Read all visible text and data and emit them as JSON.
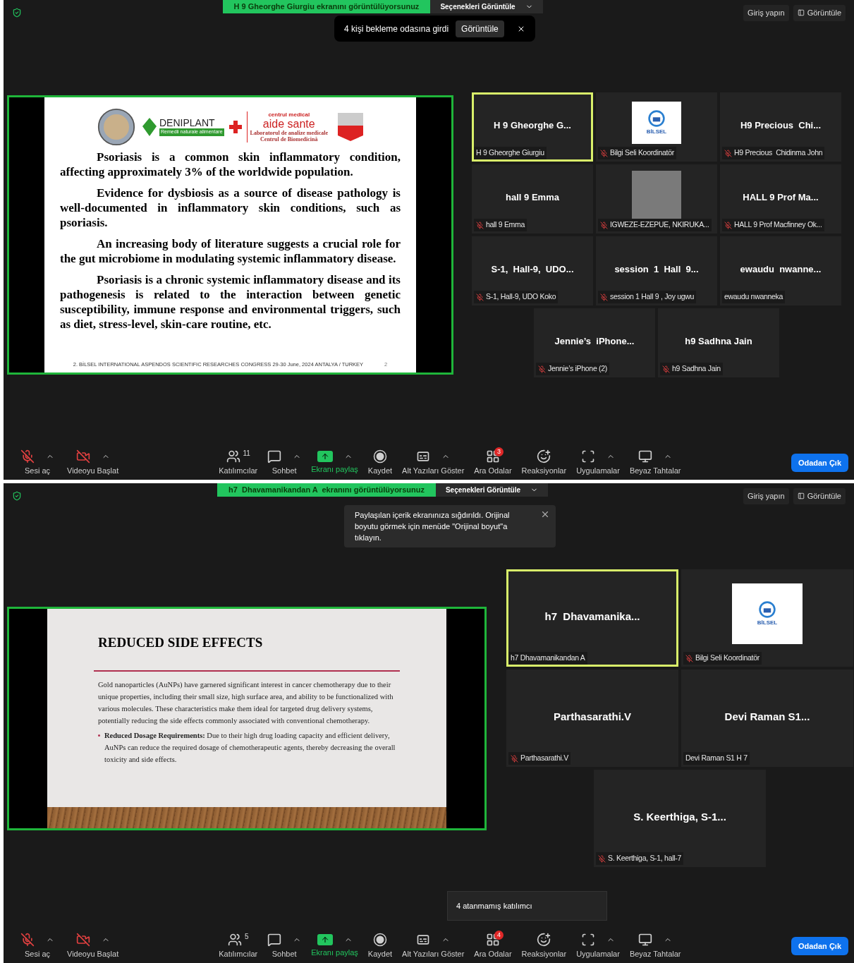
{
  "screens": [
    {
      "sharing_banner": "H 9 Gheorghe Giurgiu ekranını görüntülüyorsunuz",
      "view_options": "Seçenekleri Görüntüle",
      "sign_in": "Giriş yapın",
      "view": "Görüntüle",
      "notification": {
        "text": "4 kişi bekleme odasına girdi",
        "button": "Görüntüle"
      },
      "slide": {
        "kind": "text",
        "logos": {
          "brand": "DENIPLANT",
          "brand_tagline": "Remedii naturale alimentare",
          "clinic_top": "centrul medical",
          "clinic_name": "aide sante",
          "clinic_line_1": "Laboratorul de analize medicale",
          "clinic_line_2": "Centrul de Biomedicină"
        },
        "paragraphs": [
          "Psoriasis is a common skin inflammatory condition, affecting approximately 3% of the worldwide population.",
          "Evidence for dysbiosis as a source of disease pathology is well-documented in inflammatory skin conditions, such as psoriasis.",
          "An increasing body of literature suggests a crucial role for the gut microbiome in modulating systemic inflammatory disease.",
          "Psoriasis is a chronic systemic inflammatory disease and its pathogenesis is related to the interaction between genetic susceptibility, immune response and environmental triggers, such as diet, stress-level, skin-care routine, etc."
        ],
        "footer": "2. BİLSEL INTERNATIONAL ASPENDOS SCIENTIFIC RESEARCHES CONGRESS 29-30 June, 2024 ANTALYA / TURKEY",
        "page": "2"
      },
      "tiles": [
        {
          "kind": "name",
          "name": "H 9 Gheorghe G...",
          "label": "H 9 Gheorghe Giurgiu",
          "muted": false,
          "speaking": true
        },
        {
          "kind": "logo",
          "label": "Bilgi Seli Koordinatör",
          "muted": true,
          "speaking": false,
          "logo_text": "BİLSEL"
        },
        {
          "kind": "name",
          "name": "H9 Precious  Chi...",
          "label": "H9 Precious  Chidinma John",
          "muted": true,
          "speaking": false
        },
        {
          "kind": "name",
          "name": "hall 9 Emma",
          "label": "hall 9 Emma",
          "muted": true,
          "speaking": false
        },
        {
          "kind": "photo",
          "label": "IGWEZE-EZEPUE, NKIRUKA...",
          "muted": true,
          "speaking": false
        },
        {
          "kind": "name",
          "name": "HALL 9 Prof Ma...",
          "label": "HALL 9 Prof Macfinney Ok...",
          "muted": true,
          "speaking": false
        },
        {
          "kind": "name",
          "name": "S-1,  Hall-9,  UDO...",
          "label": "S-1, Hall-9, UDO Koko",
          "muted": true,
          "speaking": false
        },
        {
          "kind": "name",
          "name": "session  1  Hall  9...",
          "label": "session 1 Hall 9 , Joy ugwu",
          "muted": true,
          "speaking": false
        },
        {
          "kind": "name",
          "name": "ewaudu  nwanne...",
          "label": "ewaudu nwanneka",
          "muted": false,
          "speaking": false
        },
        {
          "kind": "name",
          "name": "Jennie’s  iPhone...",
          "label": "Jennie’s iPhone (2)",
          "muted": true,
          "speaking": false
        },
        {
          "kind": "name",
          "name": "h9 Sadhna Jain",
          "label": "h9 Sadhna Jain",
          "muted": true,
          "speaking": false
        }
      ],
      "toolbar": [
        {
          "kind": "mic",
          "label": "Sesi aç",
          "caret": true
        },
        {
          "kind": "video",
          "label": "Videoyu Başlat",
          "caret": true
        },
        {
          "kind": "participants",
          "label": "Katılımcılar",
          "caret": false,
          "count": "11"
        },
        {
          "kind": "chat",
          "label": "Sohbet",
          "caret": true
        },
        {
          "kind": "share",
          "label": "Ekranı paylaş",
          "caret": true
        },
        {
          "kind": "record",
          "label": "Kaydet",
          "caret": false
        },
        {
          "kind": "captions",
          "label": "Alt Yazıları Göster",
          "caret": true
        },
        {
          "kind": "rooms",
          "label": "Ara Odalar",
          "caret": false,
          "badge": "3"
        },
        {
          "kind": "reactions",
          "label": "Reaksiyonlar",
          "caret": false
        },
        {
          "kind": "apps",
          "label": "Uygulamalar",
          "caret": true
        },
        {
          "kind": "whiteboard",
          "label": "Beyaz Tahtalar",
          "caret": true
        }
      ],
      "leave": "Odadan Çık"
    },
    {
      "sharing_banner": "h7  Dhavamanikandan A  ekranını görüntülüyorsunuz",
      "view_options": "Seçenekleri Görüntüle",
      "sign_in": "Giriş yapın",
      "view": "Görüntüle",
      "tooltip": "Paylaşılan içerik ekranınıza sığdırıldı. Orijinal boyutu görmek için menüde \"Orijinal boyut\"a tıklayın.",
      "slide": {
        "kind": "title",
        "title": "REDUCED SIDE EFFECTS",
        "paragraph": "Gold nanoparticles (AuNPs) have garnered significant interest in cancer chemotherapy due to their unique properties, including their small size, high surface area, and ability to be functionalized with various molecules. These characteristics make them ideal for targeted drug delivery systems, potentially reducing the side effects commonly associated with conventional chemotherapy.",
        "bullets": [
          "**Reduced Dosage Requirements:** Due to their high drug loading capacity and efficient delivery, AuNPs can reduce the required dosage of chemotherapeutic agents, thereby decreasing the overall toxicity and side effects."
        ]
      },
      "tiles": [
        {
          "kind": "name",
          "name": "h7  Dhavamanika...",
          "label": "h7 Dhavamanikandan A",
          "muted": false,
          "speaking": true
        },
        {
          "kind": "logo",
          "label": "Bilgi Seli Koordinatör",
          "muted": true,
          "speaking": false,
          "logo_text": "BİLSEL"
        },
        {
          "kind": "name",
          "name": "Parthasarathi.V",
          "label": "Parthasarathi.V",
          "muted": true,
          "speaking": false
        },
        {
          "kind": "name",
          "name": "Devi Raman S1...",
          "label": "Devi Raman S1 H 7",
          "muted": false,
          "speaking": false
        },
        {
          "kind": "name",
          "name": "S. Keerthiga, S-1...",
          "label": "S. Keerthiga, S-1, hall-7",
          "muted": true,
          "speaking": false
        }
      ],
      "popover": "4 atanmamış katılımcı",
      "toolbar": [
        {
          "kind": "mic",
          "label": "Sesi aç",
          "caret": true
        },
        {
          "kind": "video",
          "label": "Videoyu Başlat",
          "caret": true
        },
        {
          "kind": "participants",
          "label": "Katılımcılar",
          "caret": false,
          "count": "5"
        },
        {
          "kind": "chat",
          "label": "Sohbet",
          "caret": true
        },
        {
          "kind": "share",
          "label": "Ekranı paylaş",
          "caret": true
        },
        {
          "kind": "record",
          "label": "Kaydet",
          "caret": false
        },
        {
          "kind": "captions",
          "label": "Alt Yazıları Göster",
          "caret": true
        },
        {
          "kind": "rooms",
          "label": "Ara Odalar",
          "caret": false,
          "badge": "4"
        },
        {
          "kind": "reactions",
          "label": "Reaksiyonlar",
          "caret": false
        },
        {
          "kind": "apps",
          "label": "Uygulamalar",
          "caret": true
        },
        {
          "kind": "whiteboard",
          "label": "Beyaz Tahtalar",
          "caret": true
        }
      ],
      "leave": "Odadan Çık"
    }
  ]
}
